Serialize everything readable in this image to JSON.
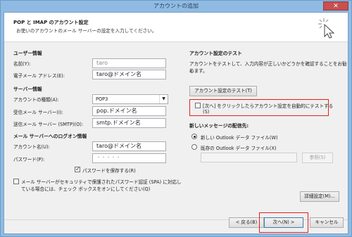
{
  "window": {
    "title": "アカウントの追加",
    "close_glyph": "✕"
  },
  "header": {
    "title": "POP と IMAP のアカウント設定",
    "subtitle": "お使いのアカウントのメール サーバーの設定を入力してください。",
    "icon": "cursor-click-icon"
  },
  "user_info": {
    "heading": "ユーザー情報",
    "name_label": "名前(Y):",
    "name_value": "taro",
    "email_label": "電子メール アドレス(E):",
    "email_value": "taro@ドメイン名"
  },
  "server_info": {
    "heading": "サーバー情報",
    "account_type_label": "アカウントの種類(A):",
    "account_type_value": "POP3",
    "incoming_label": "受信メール サーバー(I):",
    "incoming_value": "pop.ドメイン名",
    "outgoing_label": "送信メール サーバー (SMTP)(O):",
    "outgoing_value": "smtp.ドメイン名"
  },
  "logon_info": {
    "heading": "メール サーバーへのログオン情報",
    "account_name_label": "アカウント名(U):",
    "account_name_value": "taro@ドメイン名",
    "password_label": "パスワード(P):",
    "password_value": "・・・・・",
    "save_password_label": "パスワードを保存する(R)",
    "save_password_checked": true,
    "spa_label_line1": "メール サーバーがセキュリティで保護されたパスワード認証 (SPA) に対応し",
    "spa_label_line2": "ている場合には、チェック ボックスをオンにしてください(Q)",
    "spa_checked": false
  },
  "test_settings": {
    "heading": "アカウント設定のテスト",
    "description_line1": "アカウントをテストして、入力内容が正しいかどうかを確認することをお勧め",
    "description_line2": "します。",
    "test_button": "アカウント設定のテスト(T)",
    "auto_test_line1": "[次へ] をクリックしたらアカウント設定を自動的にテストする",
    "auto_test_line2": "(S)",
    "auto_test_checked": false
  },
  "delivery": {
    "heading": "新しいメッセージの配信先:",
    "option_new": "新しい Outlook データ ファイル(W)",
    "option_existing": "既存の Outlook データ ファイル(X)",
    "selected": "new",
    "browse_button": "参照(S)",
    "existing_path": ""
  },
  "more_settings_button": "詳細設定(M)...",
  "footer": {
    "back_button": "< 戻る(B)",
    "next_button": "次へ(N) >",
    "cancel_button": "キャンセル"
  },
  "colors": {
    "highlight_frame": "#e0201a",
    "title_bar": "#8fbbe3"
  }
}
